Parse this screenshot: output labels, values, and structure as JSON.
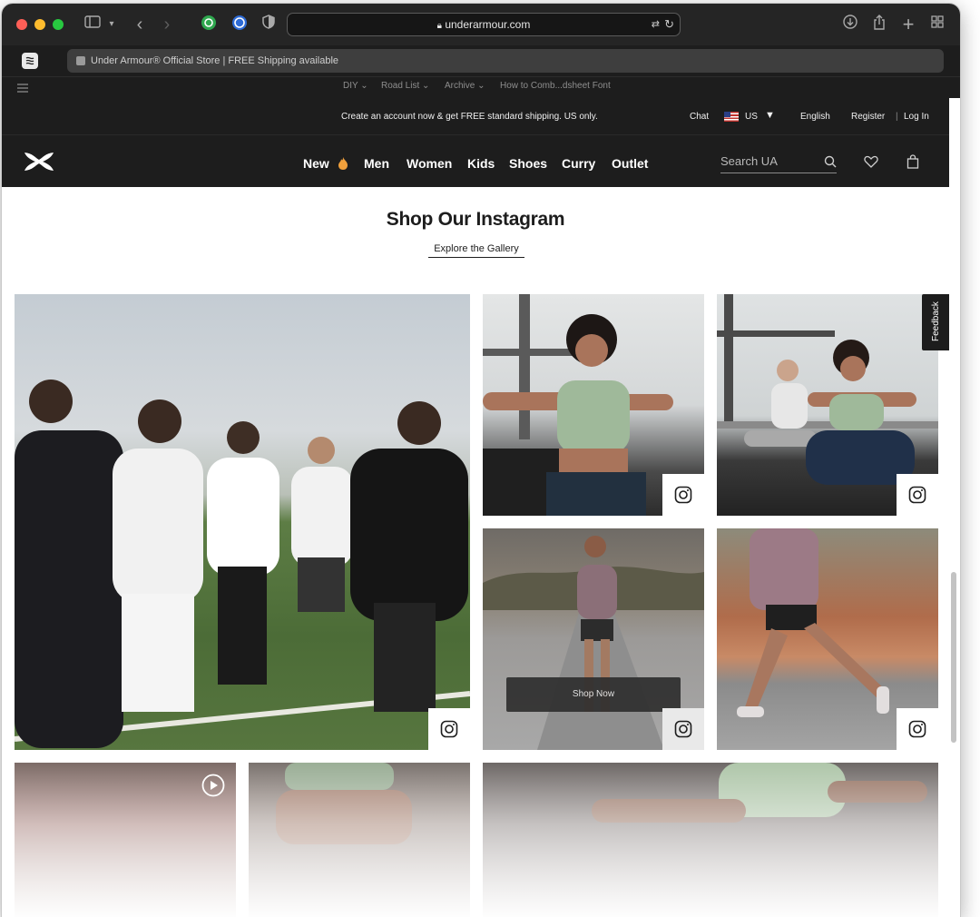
{
  "browser": {
    "url": "underarmour.com",
    "tab_title": "Under Armour® Official Store | FREE Shipping available",
    "bookmarks": [
      "DIY ⌄",
      "Road List ⌄",
      "Archive ⌄",
      "How to Comb...dsheet Font"
    ]
  },
  "promo": {
    "message": "Create an account now & get FREE standard shipping. US only.",
    "chat": "Chat",
    "country": "US",
    "language": "English",
    "register": "Register",
    "separator": "|",
    "login": "Log In"
  },
  "nav": {
    "items": [
      "New",
      "Men",
      "Women",
      "Kids",
      "Shoes",
      "Curry",
      "Outlet"
    ],
    "search_placeholder": "Search UA"
  },
  "main": {
    "heading": "Shop Our Instagram",
    "gallery_link": "Explore the Gallery",
    "shop_now": "Shop Now",
    "feedback": "Feedback"
  },
  "colors": {
    "header_bg": "#1d1d1d",
    "accent_flame": "#f0a03c"
  }
}
